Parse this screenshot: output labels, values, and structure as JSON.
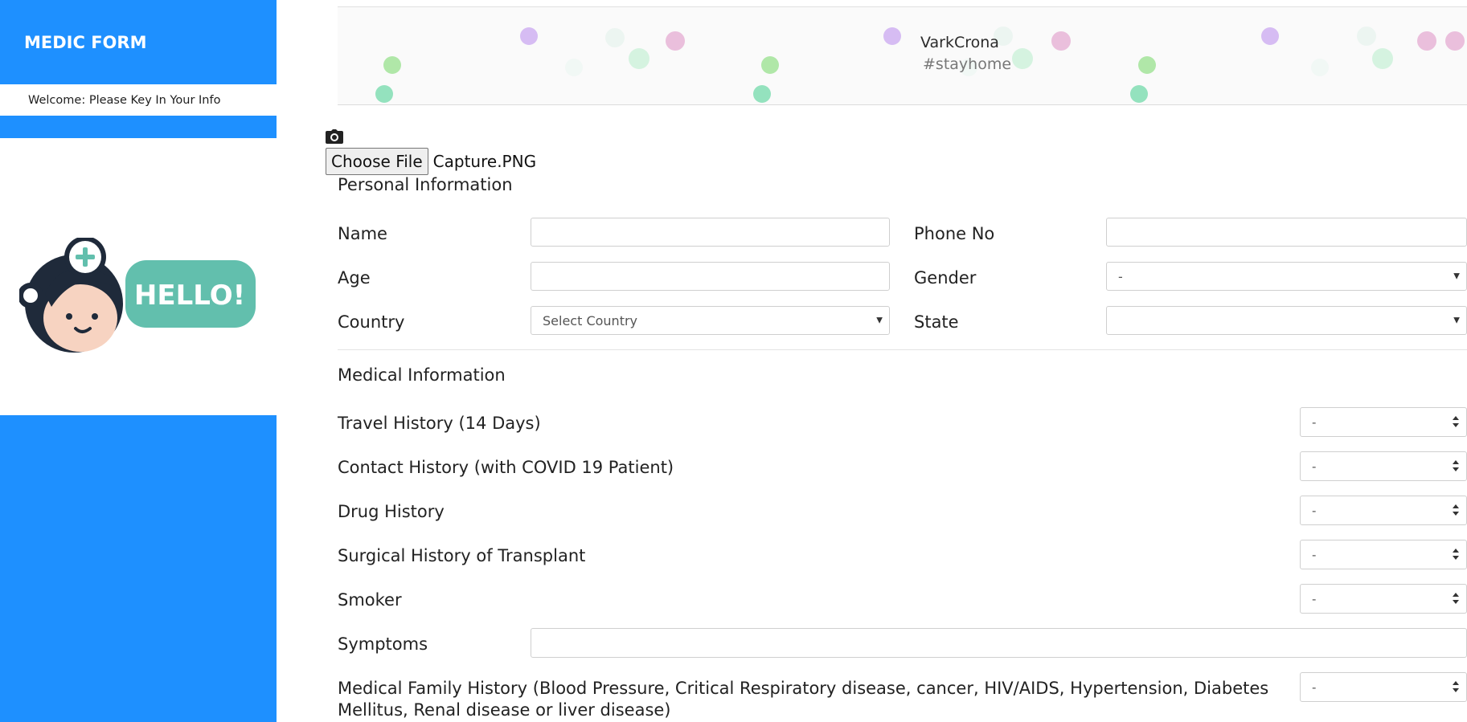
{
  "sidebar": {
    "brand": "MEDIC FORM",
    "welcome": "Welcome: Please Key In Your Info",
    "mascot_text": "HELLO!"
  },
  "banner": {
    "title": "VarkCrona",
    "subtitle": "#stayhome"
  },
  "upload": {
    "button_label": "Choose File",
    "file_name": "Capture.PNG"
  },
  "personal": {
    "title": "Personal Information",
    "name_label": "Name",
    "name_value": "",
    "phone_label": "Phone No",
    "phone_value": "",
    "age_label": "Age",
    "age_value": "",
    "gender_label": "Gender",
    "gender_value": "-",
    "country_label": "Country",
    "country_value": "Select Country",
    "state_label": "State",
    "state_value": ""
  },
  "medical": {
    "title": "Medical Information",
    "travel_label": "Travel History (14 Days)",
    "travel_value": "-",
    "contact_label": "Contact History (with COVID 19 Patient)",
    "contact_value": "-",
    "drug_label": "Drug History",
    "drug_value": "-",
    "surgical_label": "Surgical History of Transplant",
    "surgical_value": "-",
    "smoker_label": "Smoker",
    "smoker_value": "-",
    "symptoms_label": "Symptoms",
    "symptoms_value": "",
    "family_label_1": "Medical Family History (Blood Pressure, Critical Respiratory disease, cancer, HIV/AIDS, Hypertension, Diabetes",
    "family_label_2": "Mellitus, Renal disease or liver disease)",
    "family_value": "-"
  },
  "colors": {
    "sidebar_blue": "#1e90ff",
    "mascot_green": "#62bfad"
  },
  "icons": {
    "camera": "camera-icon",
    "caret": "caret-down-icon",
    "updown": "select-updown-icon"
  }
}
